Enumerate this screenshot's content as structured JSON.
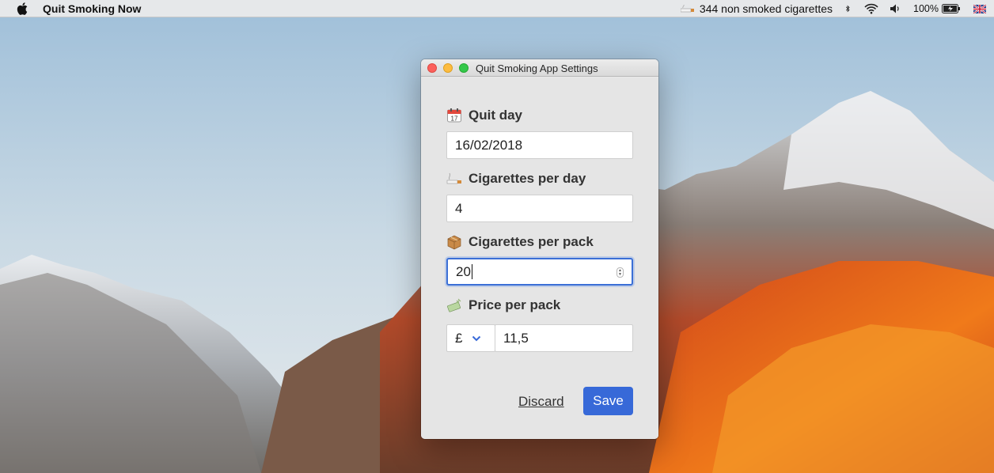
{
  "menubar": {
    "app_name": "Quit Smoking Now",
    "status_text": "344 non smoked cigarettes",
    "battery_percent": "100%"
  },
  "window": {
    "title": "Quit Smoking App Settings",
    "quit_day": {
      "label": "Quit day",
      "value": "16/02/2018",
      "icon": "calendar-icon"
    },
    "cigs_per_day": {
      "label": "Cigarettes per day",
      "value": "4",
      "icon": "cigarette-icon"
    },
    "cigs_per_pack": {
      "label": "Cigarettes per pack",
      "value": "20",
      "icon": "package-icon"
    },
    "price_per_pack": {
      "label": "Price per pack",
      "currency": "£",
      "value": "11,5",
      "icon": "money-icon"
    },
    "discard_label": "Discard",
    "save_label": "Save"
  },
  "colors": {
    "accent": "#3769d8",
    "close": "#fc605c",
    "minimize": "#fdbc40",
    "maximize": "#34c84a"
  }
}
